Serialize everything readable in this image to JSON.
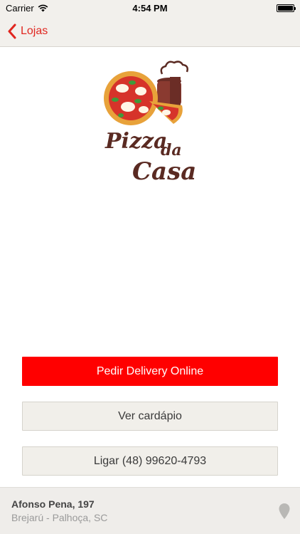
{
  "status_bar": {
    "carrier": "Carrier",
    "time": "4:54 PM",
    "battery_level": 1.0
  },
  "nav": {
    "back_label": "Lojas"
  },
  "logo": {
    "line1": "Pizza",
    "line2": "da",
    "line3": "Casa"
  },
  "actions": {
    "delivery_label": "Pedir Delivery Online",
    "menu_label": "Ver cardápio",
    "call_label": "Ligar (48) 99620-4793"
  },
  "store": {
    "street": "Afonso Pena, 197",
    "city": "Brejarú - Palhoça, SC"
  },
  "colors": {
    "accent": "#e0261f",
    "primary_button": "#ff0000",
    "logo_brown": "#5a2a22"
  },
  "icons": {
    "back": "chevron-left-icon",
    "wifi": "wifi-icon",
    "battery": "battery-icon",
    "location": "map-pin-icon"
  }
}
